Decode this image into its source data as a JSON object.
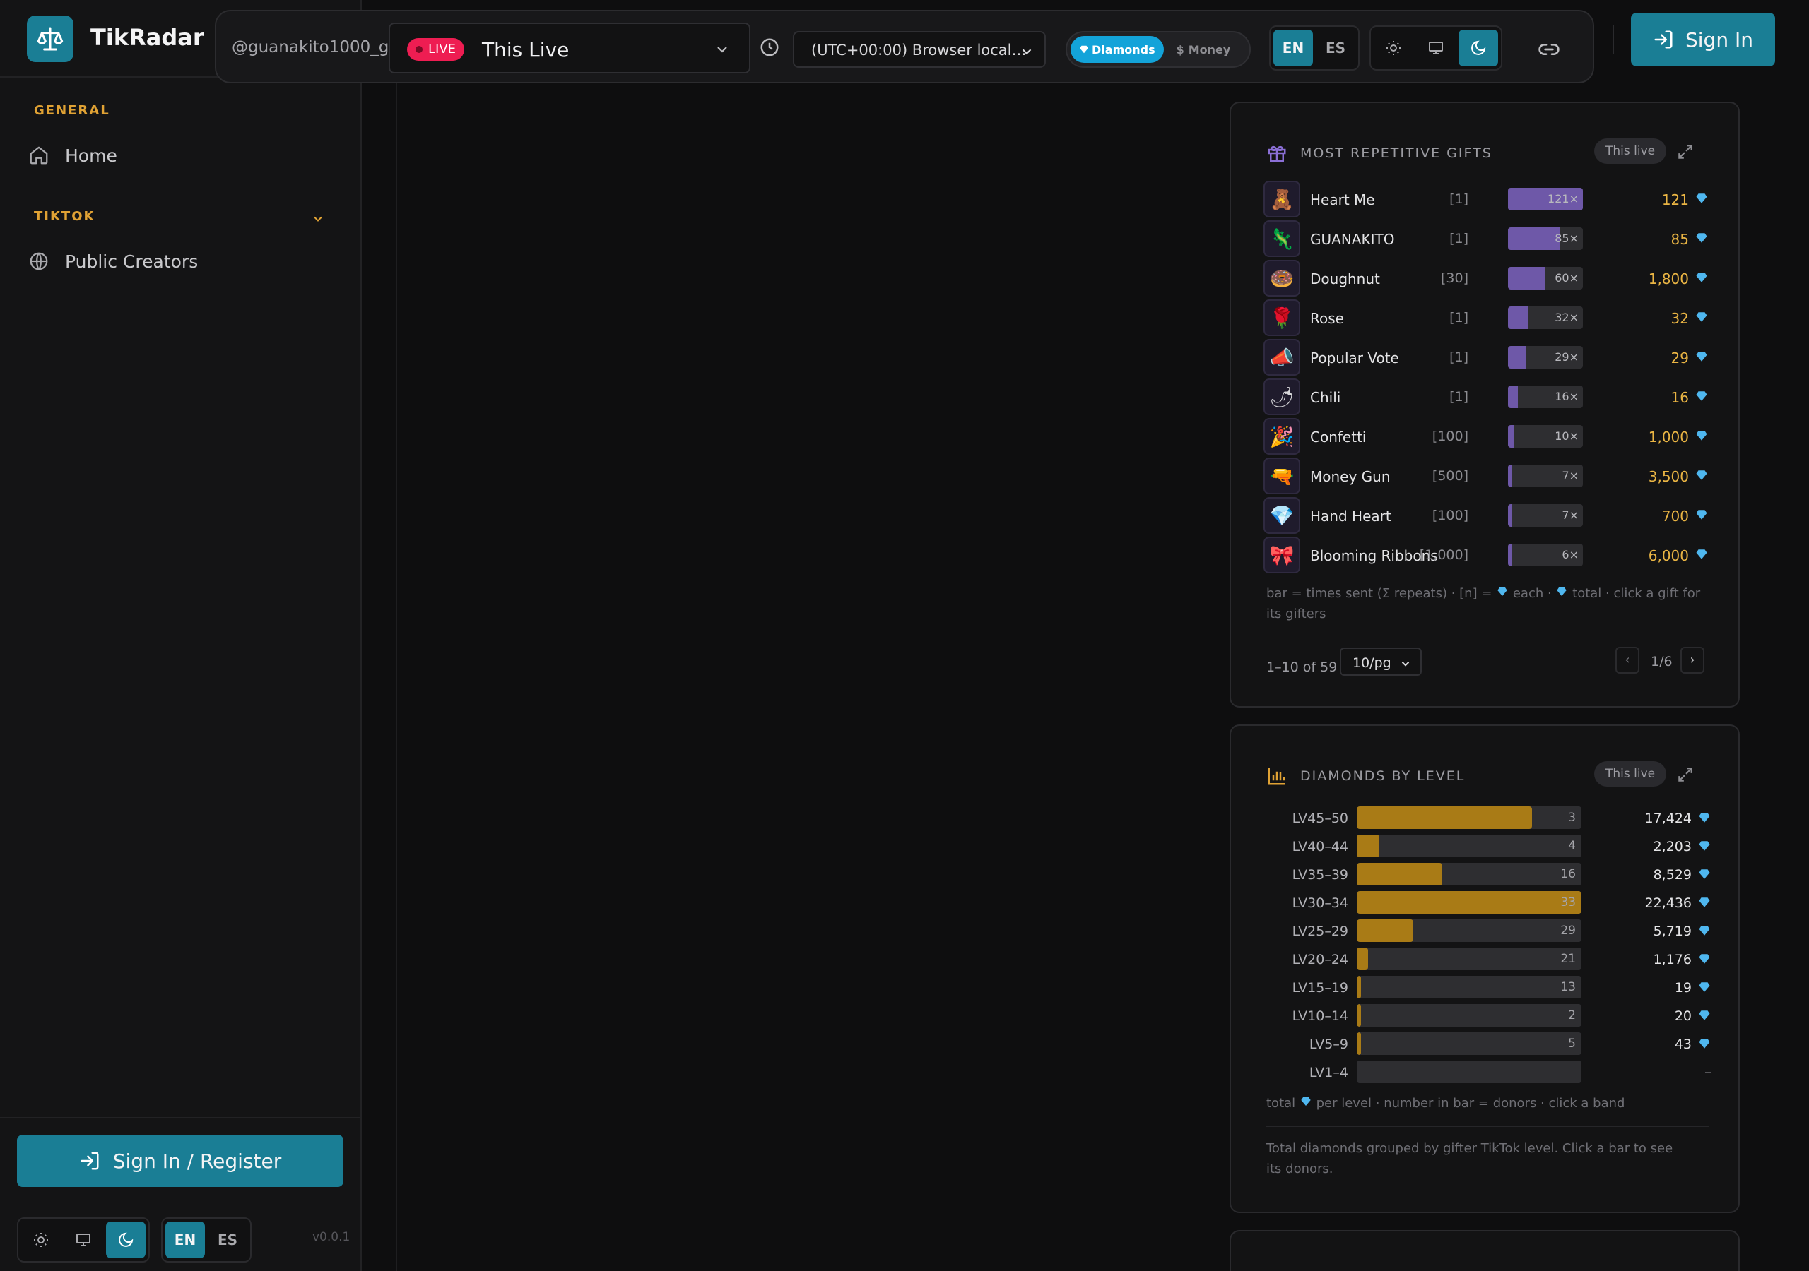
{
  "brand": {
    "name": "TikRadar"
  },
  "sidebar": {
    "sections": [
      {
        "title": "GENERAL",
        "items": [
          {
            "label": "Home",
            "icon": "home-icon"
          }
        ]
      },
      {
        "title": "TIKTOK",
        "items": [
          {
            "label": "Public Creators",
            "icon": "globe-icon"
          }
        ]
      }
    ],
    "signin_label": "Sign In / Register",
    "theme_options": [
      "light",
      "system",
      "dark"
    ],
    "theme_active": "dark",
    "lang_options": [
      "EN",
      "ES"
    ],
    "lang_active": "EN",
    "version": "v0.0.1"
  },
  "topbar": {
    "handle": "@guanakito1000_g",
    "live_badge": "LIVE",
    "live_select": "This Live",
    "timezone": "(UTC+00:00) Browser local…",
    "currency": {
      "options": [
        "Diamonds",
        "Money"
      ],
      "active": "Diamonds"
    },
    "lang_options": [
      "EN",
      "ES"
    ],
    "lang_active": "EN",
    "theme_options": [
      "light",
      "system",
      "dark"
    ],
    "theme_active": "dark",
    "signin_label": "Sign In"
  },
  "gifts_card": {
    "title": "MOST REPETITIVE GIFTS",
    "scope_chip": "This live",
    "gifts": [
      {
        "name": "Heart Me",
        "unit": "[1]",
        "times": 121,
        "times_label": "121×",
        "total": "121",
        "emoji": "🧸"
      },
      {
        "name": "GUANAKITO",
        "unit": "[1]",
        "times": 85,
        "times_label": "85×",
        "total": "85",
        "emoji": "🦎"
      },
      {
        "name": "Doughnut",
        "unit": "[30]",
        "times": 60,
        "times_label": "60×",
        "total": "1,800",
        "emoji": "🍩"
      },
      {
        "name": "Rose",
        "unit": "[1]",
        "times": 32,
        "times_label": "32×",
        "total": "32",
        "emoji": "🌹"
      },
      {
        "name": "Popular Vote",
        "unit": "[1]",
        "times": 29,
        "times_label": "29×",
        "total": "29",
        "emoji": "📣"
      },
      {
        "name": "Chili",
        "unit": "[1]",
        "times": 16,
        "times_label": "16×",
        "total": "16",
        "emoji": "🌶"
      },
      {
        "name": "Confetti",
        "unit": "[100]",
        "times": 10,
        "times_label": "10×",
        "total": "1,000",
        "emoji": "🎉"
      },
      {
        "name": "Money Gun",
        "unit": "[500]",
        "times": 7,
        "times_label": "7×",
        "total": "3,500",
        "emoji": "🔫"
      },
      {
        "name": "Hand Heart",
        "unit": "[100]",
        "times": 7,
        "times_label": "7×",
        "total": "700",
        "emoji": "💎"
      },
      {
        "name": "Blooming Ribbons",
        "unit": "[1,000]",
        "times": 6,
        "times_label": "6×",
        "total": "6,000",
        "emoji": "🎀"
      }
    ],
    "note_parts": [
      "bar = times sent (Σ repeats) · [n] = ",
      " each · ",
      " total · click a gift for its gifters"
    ],
    "pager": {
      "range": "1–10 of 59",
      "per_page": "10/pg",
      "page": "1/6",
      "prev": "‹",
      "next": "›"
    }
  },
  "levels_card": {
    "title": "DIAMONDS BY LEVEL",
    "scope_chip": "This live",
    "levels": [
      {
        "band": "LV45–50",
        "donors": "3",
        "total": "17,424",
        "diamonds": 17424
      },
      {
        "band": "LV40–44",
        "donors": "4",
        "total": "2,203",
        "diamonds": 2203
      },
      {
        "band": "LV35–39",
        "donors": "16",
        "total": "8,529",
        "diamonds": 8529
      },
      {
        "band": "LV30–34",
        "donors": "33",
        "total": "22,436",
        "diamonds": 22436
      },
      {
        "band": "LV25–29",
        "donors": "29",
        "total": "5,719",
        "diamonds": 5719
      },
      {
        "band": "LV20–24",
        "donors": "21",
        "total": "1,176",
        "diamonds": 1176
      },
      {
        "band": "LV15–19",
        "donors": "13",
        "total": "19",
        "diamonds": 19
      },
      {
        "band": "LV10–14",
        "donors": "2",
        "total": "20",
        "diamonds": 20
      },
      {
        "band": "LV5–9",
        "donors": "5",
        "total": "43",
        "diamonds": 43
      },
      {
        "band": "LV1–4",
        "donors": "",
        "total": "–",
        "diamonds": 0
      }
    ],
    "note_parts": [
      "total ",
      " per level · number in bar = donors · click a band"
    ],
    "description": "Total diamonds grouped by gifter TikTok level. Click a bar to see its donors."
  },
  "colors": {
    "accent": "#1a7e95",
    "live": "#ee1d52",
    "gift_bar": "#6e58a8",
    "level_bar": "#a97b16",
    "gold_text": "#eab544",
    "section_label": "#e0a234",
    "diamond_toggle": "#13a3d9"
  }
}
